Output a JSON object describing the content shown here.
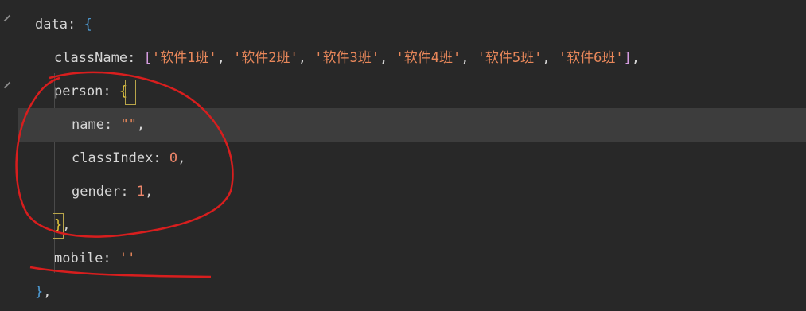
{
  "code": {
    "data_kw": "data",
    "classname_kw": "className",
    "classname_values": [
      "'软件1班'",
      "'软件2班'",
      "'软件3班'",
      "'软件4班'",
      "'软件5班'",
      "'软件6班'"
    ],
    "person_kw": "person",
    "name_kw": "name",
    "name_val": "\"\"",
    "classindex_kw": "classIndex",
    "classindex_val": "0",
    "gender_kw": "gender",
    "gender_val": "1",
    "mobile_kw": "mobile",
    "mobile_val": "''",
    "colon": ": ",
    "comma": ",",
    "comma_sp": ", ",
    "open_brace": "{",
    "close_brace": "}",
    "open_bracket": "[",
    "close_bracket": "]"
  },
  "colors": {
    "background": "#282828",
    "active_line": "#3d3d3d",
    "annotation": "#d81e1e"
  },
  "icons": [
    "fold-arrow-icon"
  ]
}
